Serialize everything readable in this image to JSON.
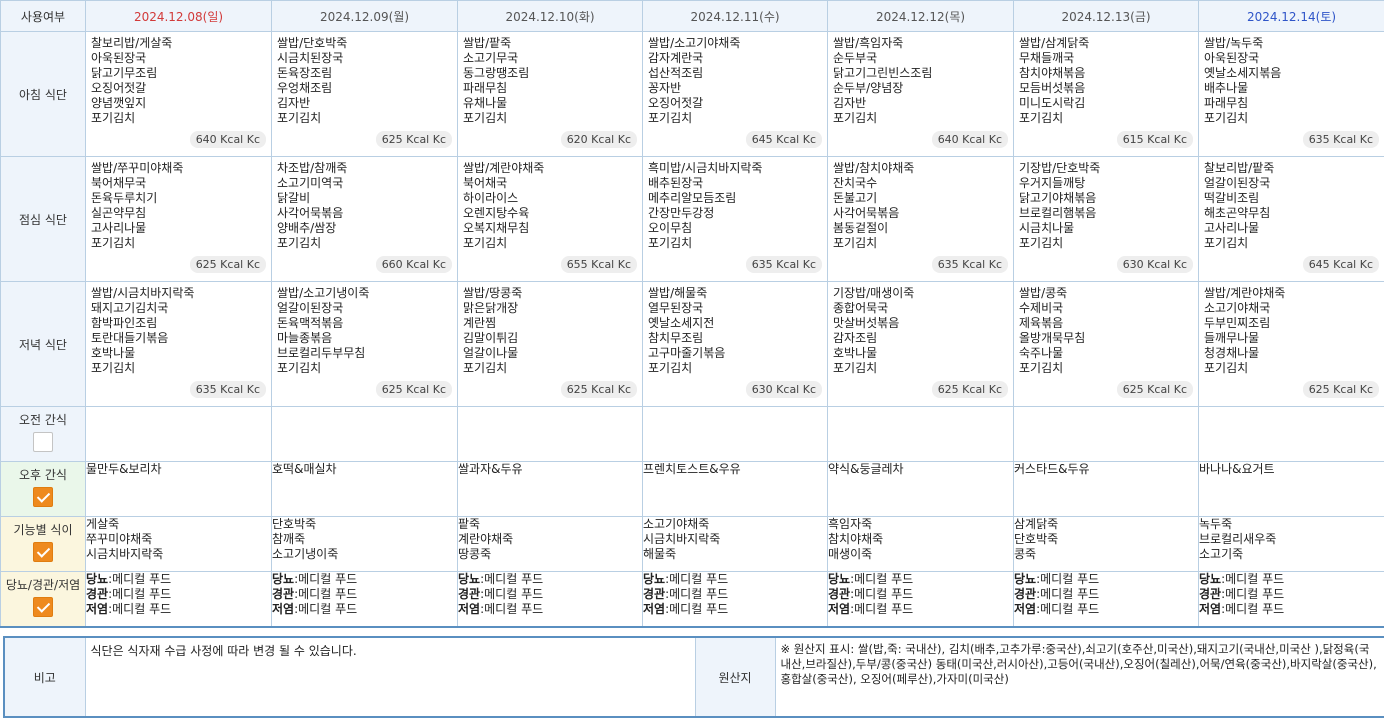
{
  "header": {
    "corner_label": "사용여부",
    "dates": [
      "2024.12.08(일)",
      "2024.12.09(월)",
      "2024.12.10(화)",
      "2024.12.11(수)",
      "2024.12.12(목)",
      "2024.12.13(금)",
      "2024.12.14(토)"
    ]
  },
  "colors": {
    "sunday": "#d23a3a",
    "saturday": "#2f55c8",
    "checkbox_checked": "#ee8a1e"
  },
  "meals": [
    {
      "label": "아침 식단",
      "days": [
        {
          "items": [
            "찰보리밥/게살죽",
            "아욱된장국",
            "닭고기무조림",
            "오징어젓갈",
            "양념깻잎지",
            "포기김치"
          ],
          "kcal": "640 Kcal Kc"
        },
        {
          "items": [
            "쌀밥/단호박죽",
            "시금치된장국",
            "돈육장조림",
            "우엉채조림",
            "김자반",
            "포기김치"
          ],
          "kcal": "625 Kcal Kc"
        },
        {
          "items": [
            "쌀밥/팥죽",
            "소고기무국",
            "동그랑땡조림",
            "파래무침",
            "유채나물",
            "포기김치"
          ],
          "kcal": "620 Kcal Kc"
        },
        {
          "items": [
            "쌀밥/소고기야채죽",
            "감자계란국",
            "섭산적조림",
            "꽁자반",
            "오징어젓갈",
            "포기김치"
          ],
          "kcal": "645 Kcal Kc"
        },
        {
          "items": [
            "쌀밥/흑임자죽",
            "순두부국",
            "닭고기그린빈스조림",
            "순두부/양념장",
            "김자반",
            "포기김치"
          ],
          "kcal": "640 Kcal Kc"
        },
        {
          "items": [
            "쌀밥/삼계닭죽",
            "무채들깨국",
            "참치야채볶음",
            "모듬버섯볶음",
            "미니도시락김",
            "포기김치"
          ],
          "kcal": "615 Kcal Kc"
        },
        {
          "items": [
            "쌀밥/녹두죽",
            "아욱된장국",
            "옛날소세지볶음",
            "배추나물",
            "파래무침",
            "포기김치"
          ],
          "kcal": "635 Kcal Kc"
        }
      ]
    },
    {
      "label": "점심 식단",
      "days": [
        {
          "items": [
            "쌀밥/쭈꾸미야채죽",
            "북어채무국",
            "돈육두루치기",
            "실곤약무침",
            "고사리나물",
            "포기김치"
          ],
          "kcal": "625 Kcal Kc"
        },
        {
          "items": [
            "차조밥/참깨죽",
            "소고기미역국",
            "닭갈비",
            "사각어묵볶음",
            "양배추/쌈장",
            "포기김치"
          ],
          "kcal": "660 Kcal Kc"
        },
        {
          "items": [
            "쌀밥/계란야채죽",
            "북어채국",
            "하이라이스",
            "오렌지탕수육",
            "오복지채무침",
            "포기김치"
          ],
          "kcal": "655 Kcal Kc"
        },
        {
          "items": [
            "흑미밥/시금치바지락죽",
            "배추된장국",
            "메추리알모듬조림",
            "간장만두강정",
            "오이무침",
            "포기김치"
          ],
          "kcal": "635 Kcal Kc"
        },
        {
          "items": [
            "쌀밥/참치야채죽",
            "잔치국수",
            "돈불고기",
            "사각어묵볶음",
            "봄동겉절이",
            "포기김치"
          ],
          "kcal": "635 Kcal Kc"
        },
        {
          "items": [
            "기장밥/단호박죽",
            "우거지들깨탕",
            "닭고기야채볶음",
            "브로컬리햄볶음",
            "시금치나물",
            "포기김치"
          ],
          "kcal": "630 Kcal Kc"
        },
        {
          "items": [
            "찰보리밥/팥죽",
            "얼갈이된장국",
            "떡갈비조림",
            "해초곤약무침",
            "고사리나물",
            "포기김치"
          ],
          "kcal": "645 Kcal Kc"
        }
      ]
    },
    {
      "label": "저녁 식단",
      "days": [
        {
          "items": [
            "쌀밥/시금치바지락죽",
            "돼지고기김치국",
            "함박파인조림",
            "토란대들기볶음",
            "호박나물",
            "포기김치"
          ],
          "kcal": "635 Kcal Kc"
        },
        {
          "items": [
            "쌀밥/소고기냉이죽",
            "얼갈이된장국",
            "돈육맥적볶음",
            "마늘종볶음",
            "브로컬리두부무침",
            "포기김치"
          ],
          "kcal": "625 Kcal Kc"
        },
        {
          "items": [
            "쌀밥/땅콩죽",
            "맑은닭개장",
            "계란찜",
            "김말이튀김",
            "얼갈이나물",
            "포기김치"
          ],
          "kcal": "625 Kcal Kc"
        },
        {
          "items": [
            "쌀밥/해물죽",
            "열무된장국",
            "옛날소세지전",
            "참치무조림",
            "고구마줄기볶음",
            "포기김치"
          ],
          "kcal": "630 Kcal Kc"
        },
        {
          "items": [
            "기장밥/매생이죽",
            "종합어묵국",
            "맛살버섯볶음",
            "감자조림",
            "호박나물",
            "포기김치"
          ],
          "kcal": "625 Kcal Kc"
        },
        {
          "items": [
            "쌀밥/콩죽",
            "수제비국",
            "제육볶음",
            "올방개묵무침",
            "숙주나물",
            "포기김치"
          ],
          "kcal": "625 Kcal Kc"
        },
        {
          "items": [
            "쌀밥/계란야채죽",
            "소고기야채국",
            "두부민찌조림",
            "들깨무나물",
            "청경채나물",
            "포기김치"
          ],
          "kcal": "625 Kcal Kc"
        }
      ]
    }
  ],
  "snacks": {
    "morning": {
      "label": "오전 간식",
      "checked": false,
      "days": [
        "",
        "",
        "",
        "",
        "",
        "",
        ""
      ]
    },
    "afternoon": {
      "label": "오후 간식",
      "checked": true,
      "days": [
        "물만두&보리차",
        "호떡&매실차",
        "쌀과자&두유",
        "프렌치토스트&우유",
        "약식&둥글레차",
        "커스타드&두유",
        "바나나&요거트"
      ]
    }
  },
  "functional": {
    "label": "기능별 식이",
    "checked": true,
    "days": [
      [
        "게살죽",
        "쭈꾸미야채죽",
        "시금치바지락죽"
      ],
      [
        "단호박죽",
        "참깨죽",
        "소고기냉이죽"
      ],
      [
        "팥죽",
        "계란야채죽",
        "땅콩죽"
      ],
      [
        "소고기야채죽",
        "시금치바지락죽",
        "해물죽"
      ],
      [
        "흑임자죽",
        "참치야채죽",
        "매생이죽"
      ],
      [
        "삼계닭죽",
        "단호박죽",
        "콩죽"
      ],
      [
        "녹두죽",
        "브로컬리새우죽",
        "소고기죽"
      ]
    ]
  },
  "diet": {
    "label": "당뇨/경관/저염",
    "checked": true,
    "rows": [
      {
        "key": "당뇨",
        "value": ":메디컬 푸드"
      },
      {
        "key": "경관",
        "value": ":메디컬 푸드"
      },
      {
        "key": "저염",
        "value": ":메디컬 푸드"
      }
    ]
  },
  "remark": {
    "label": "비고",
    "text": "식단은 식자재 수급 사정에 따라 변경 될 수 있습니다.",
    "origin_label": "원산지",
    "origin_text": "※ 원산지 표시: 쌀(밥,죽: 국내산), 김치(배추,고추가루:중국산),쇠고기(호주산,미국산),돼지고기(국내산,미국산 ),닭정육(국내산,브라질산),두부/콩(중국산) 동태(미국산,러시아산),고등어(국내산),오징어(칠레산),어묵/연육(중국산),바지락살(중국산),홍합살(중국산), 오징어(페루산),가자미(미국산)"
  }
}
